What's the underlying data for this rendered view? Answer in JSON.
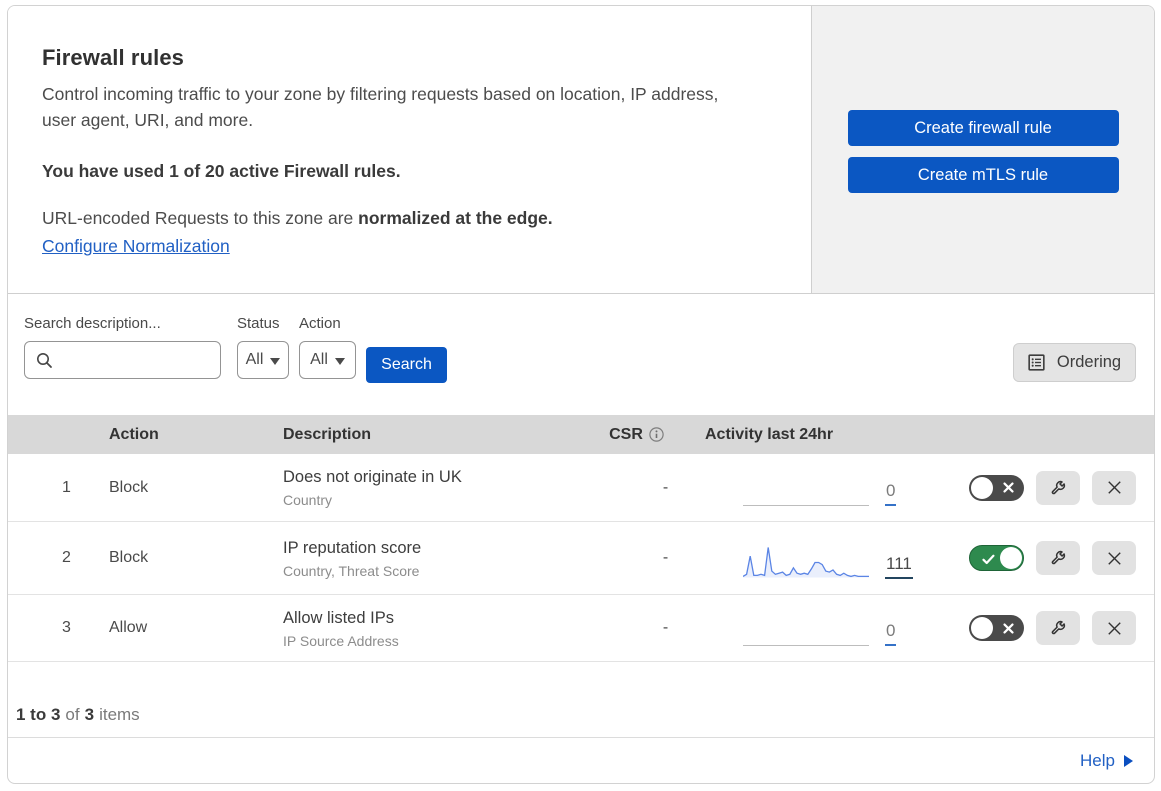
{
  "header": {
    "title": "Firewall rules",
    "description": "Control incoming traffic to your zone by filtering requests based on location, IP address, user agent, URI, and more.",
    "usage_note": "You have used 1 of 20 active Firewall rules.",
    "normalization_prefix": "URL-encoded Requests to this zone are ",
    "normalization_bold": "normalized at the edge.",
    "normalization_link": "Configure Normalization",
    "create_firewall_button": "Create firewall rule",
    "create_mtls_button": "Create mTLS rule"
  },
  "filters": {
    "search_label": "Search description...",
    "search_value": "",
    "status_label": "Status",
    "status_value": "All",
    "action_label": "Action",
    "action_value": "All",
    "search_button": "Search",
    "ordering_button": "Ordering"
  },
  "table": {
    "columns": {
      "action": "Action",
      "description": "Description",
      "csr": "CSR",
      "activity": "Activity last 24hr"
    },
    "rows": [
      {
        "number": "1",
        "action": "Block",
        "description": "Does not originate in UK",
        "description_sub": "Country",
        "csr": "-",
        "activity_count": "0",
        "enabled": false
      },
      {
        "number": "2",
        "action": "Block",
        "description": "IP reputation score",
        "description_sub": "Country, Threat Score",
        "csr": "-",
        "activity_count": "111",
        "enabled": true
      },
      {
        "number": "3",
        "action": "Allow",
        "description": "Allow listed IPs",
        "description_sub": "IP Source Address",
        "csr": "-",
        "activity_count": "0",
        "enabled": false
      }
    ]
  },
  "sparkline": {
    "row_index": 1,
    "values": [
      1,
      3,
      20,
      2,
      2,
      3,
      2,
      28,
      6,
      3,
      4,
      5,
      2,
      3,
      9,
      4,
      3,
      4,
      3,
      8,
      14,
      14,
      12,
      6,
      5,
      7,
      3,
      2,
      4,
      2,
      1,
      2,
      1,
      1,
      1,
      1
    ],
    "line_color": "#5b85e5",
    "fill_color": "rgba(91,133,229,0.13)"
  },
  "footer": {
    "range": "1 to 3",
    "of": "of",
    "total": "3",
    "items": "items",
    "help_link": "Help"
  },
  "colors": {
    "primary_blue": "#0b57c2",
    "link_blue": "#2160c4",
    "toggle_on_green": "#2e8a4e",
    "toggle_off_gray": "#4a4a4a",
    "header_gray": "#d8d8d8",
    "panel_gray": "#f1f1f1"
  }
}
